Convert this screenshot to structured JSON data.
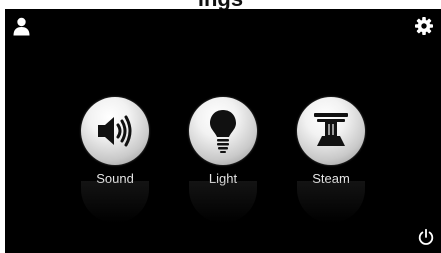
{
  "page": {
    "clipped_title": "ings"
  },
  "menu": {
    "items": [
      {
        "id": "sound",
        "label": "Sound",
        "icon": "speaker-icon"
      },
      {
        "id": "light",
        "label": "Light",
        "icon": "lightbulb-icon"
      },
      {
        "id": "steam",
        "label": "Steam",
        "icon": "steam-icon"
      }
    ]
  },
  "toolbar": {
    "user_icon": "user-icon",
    "settings_icon": "gear-icon",
    "power_icon": "power-icon"
  },
  "colors": {
    "background": "#000000",
    "label": "#e6e6e6",
    "orb_highlight": "#ffffff",
    "orb_shadow": "#8c8c8c",
    "glyph": "#111111"
  }
}
